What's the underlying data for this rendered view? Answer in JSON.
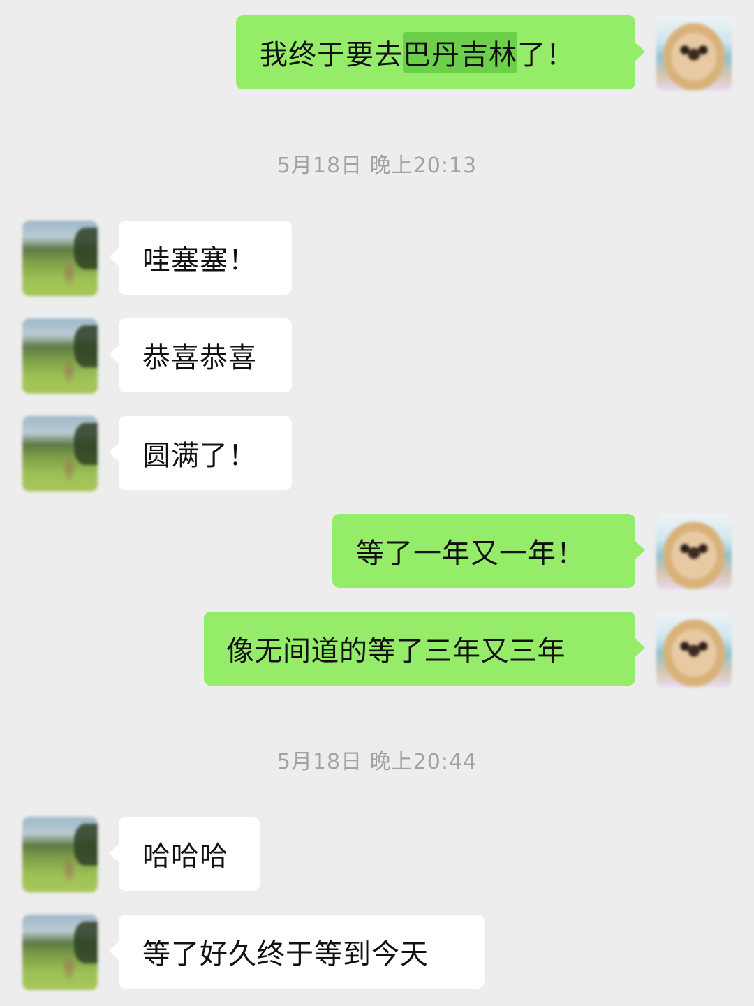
{
  "colors": {
    "background": "#ededed",
    "outgoing_bubble": "#95ec69",
    "incoming_bubble": "#ffffff",
    "highlight": "#6cd04a",
    "timestamp_text": "#a2a2a2"
  },
  "messages": [
    {
      "direction": "outgoing",
      "avatar": "user-avatar",
      "text_pre": "我终于要去",
      "text_highlight": "巴丹吉林",
      "text_post": "了！"
    },
    {
      "type": "timestamp",
      "text": "5月18日 晚上20:13"
    },
    {
      "direction": "incoming",
      "avatar": "friend-avatar",
      "text": "哇塞塞！"
    },
    {
      "direction": "incoming",
      "avatar": "friend-avatar",
      "text": "恭喜恭喜"
    },
    {
      "direction": "incoming",
      "avatar": "friend-avatar",
      "text": "圆满了！"
    },
    {
      "direction": "outgoing",
      "avatar": "user-avatar",
      "text": "等了一年又一年！"
    },
    {
      "direction": "outgoing",
      "avatar": "user-avatar",
      "text": "像无间道的等了三年又三年"
    },
    {
      "type": "timestamp",
      "text": "5月18日 晚上20:44"
    },
    {
      "direction": "incoming",
      "avatar": "friend-avatar",
      "text": "哈哈哈"
    },
    {
      "direction": "incoming",
      "avatar": "friend-avatar",
      "text": "等了好久终于等到今天"
    }
  ]
}
